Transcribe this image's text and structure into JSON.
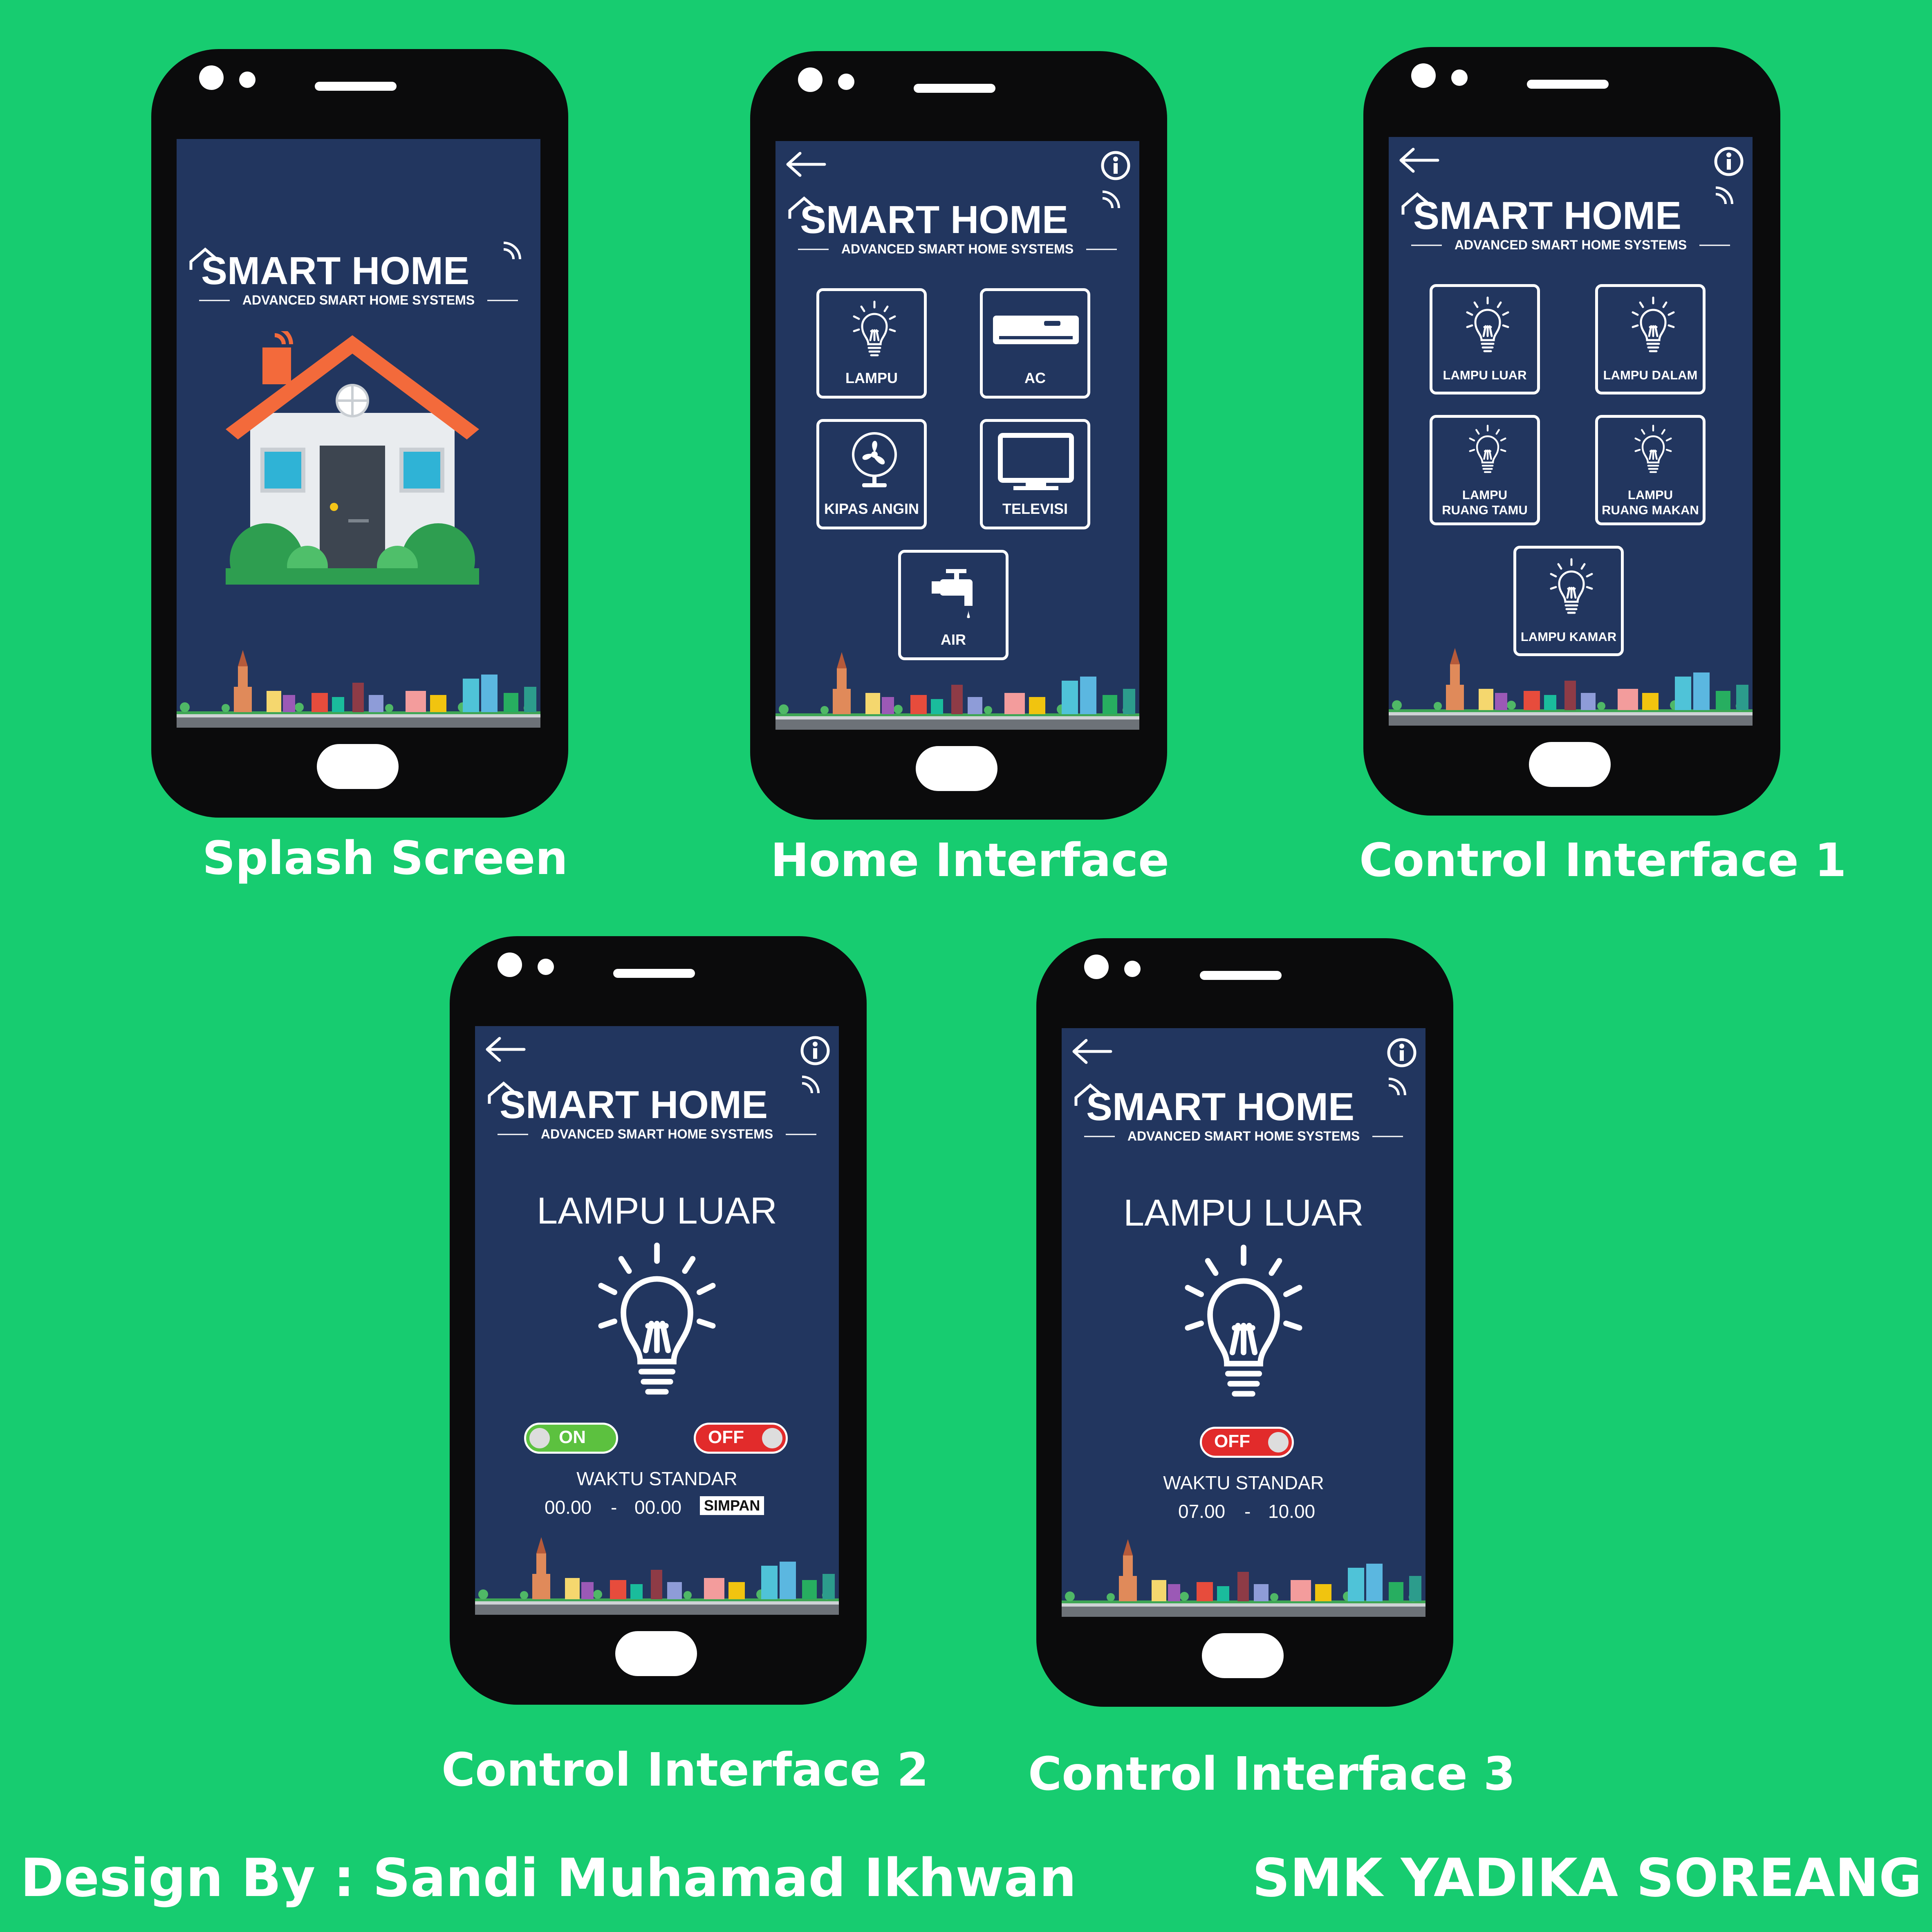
{
  "colors": {
    "background": "#17cc70",
    "phone_body": "#0b0b0c",
    "screen": "#22365f",
    "toggle_on": "#5cc13f",
    "toggle_off": "#e22b2b",
    "roof": "#f36a3b"
  },
  "brand": {
    "title": "SMART HOME",
    "subtitle": "ADVANCED SMART HOME SYSTEMS"
  },
  "icons": {
    "back": "back-arrow-icon",
    "info": "info-icon",
    "lamp": "light-bulb-icon",
    "ac": "air-conditioner-icon",
    "fan": "fan-icon",
    "tv": "television-icon",
    "water": "water-tap-icon"
  },
  "screens": {
    "splash": {
      "caption": "Splash Screen"
    },
    "home": {
      "caption": "Home Interface",
      "tiles": [
        "LAMPU",
        "AC",
        "KIPAS ANGIN",
        "TELEVISI",
        "AIR"
      ]
    },
    "control1": {
      "caption": "Control Interface 1",
      "tiles": [
        "LAMPU LUAR",
        "LAMPU DALAM",
        "LAMPU\nRUANG TAMU",
        "LAMPU\nRUANG MAKAN",
        "LAMPU KAMAR"
      ]
    },
    "control2": {
      "caption": "Control Interface 2",
      "title": "LAMPU LUAR",
      "toggle_on": "ON",
      "toggle_off": "OFF",
      "time_label": "WAKTU STANDAR",
      "time_start": "00.00",
      "time_sep": "-",
      "time_end": "00.00",
      "save_label": "SIMPAN"
    },
    "control3": {
      "caption": "Control Interface 3",
      "title": "LAMPU LUAR",
      "toggle_off": "OFF",
      "time_label": "WAKTU STANDAR",
      "time_start": "07.00",
      "time_sep": "-",
      "time_end": "10.00"
    }
  },
  "footer": {
    "designer": "Design By : Sandi Muhamad Ikhwan",
    "school": "SMK YADIKA SOREANG"
  }
}
